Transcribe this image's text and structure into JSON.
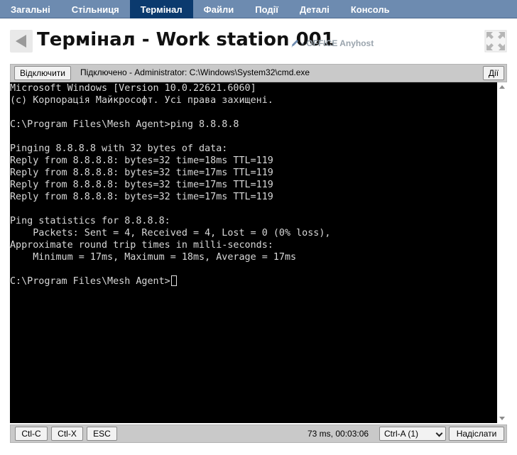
{
  "tabs": [
    {
      "label": "Загальні",
      "active": false
    },
    {
      "label": "Стільниця",
      "active": false
    },
    {
      "label": "Термінал",
      "active": true
    },
    {
      "label": "Файли",
      "active": false
    },
    {
      "label": "Події",
      "active": false
    },
    {
      "label": "Деталі",
      "active": false
    },
    {
      "label": "Консоль",
      "active": false
    }
  ],
  "header": {
    "title": "Термінал - Work station 001",
    "subtitle": "- OFFICE Anyhost",
    "icons": {
      "back": "back-arrow-icon",
      "edit": "pencil-icon",
      "fullscreen": "fullscreen-icon"
    }
  },
  "terminal_toolbar": {
    "disconnect_label": "Відключити",
    "status": "Підключено - Administrator: C:\\Windows\\System32\\cmd.exe",
    "actions_label": "Дії"
  },
  "terminal": {
    "lines": [
      "Microsoft Windows [Version 10.0.22621.6060]",
      "(c) Корпорація Майкрософт. Усі права захищені.",
      "",
      "C:\\Program Files\\Mesh Agent>ping 8.8.8.8",
      "",
      "Pinging 8.8.8.8 with 32 bytes of data:",
      "Reply from 8.8.8.8: bytes=32 time=18ms TTL=119",
      "Reply from 8.8.8.8: bytes=32 time=17ms TTL=119",
      "Reply from 8.8.8.8: bytes=32 time=17ms TTL=119",
      "Reply from 8.8.8.8: bytes=32 time=17ms TTL=119",
      "",
      "Ping statistics for 8.8.8.8:",
      "    Packets: Sent = 4, Received = 4, Lost = 0 (0% loss),",
      "Approximate round trip times in milli-seconds:",
      "    Minimum = 17ms, Maximum = 18ms, Average = 17ms",
      ""
    ],
    "prompt": "C:\\Program Files\\Mesh Agent>",
    "colors": {
      "background": "#000000",
      "foreground": "#d8d8d8"
    }
  },
  "bottom_toolbar": {
    "ctrl_c_label": "Ctl-C",
    "ctrl_x_label": "Ctl-X",
    "esc_label": "ESC",
    "latency": "73 ms, 00:03:06",
    "key_select_value": "Ctrl-A (1)",
    "send_label": "Надіслати"
  },
  "colors": {
    "tabbar": "#6d8bb0",
    "tab_active": "#0b3a6e",
    "toolbar": "#c9c9c9"
  }
}
